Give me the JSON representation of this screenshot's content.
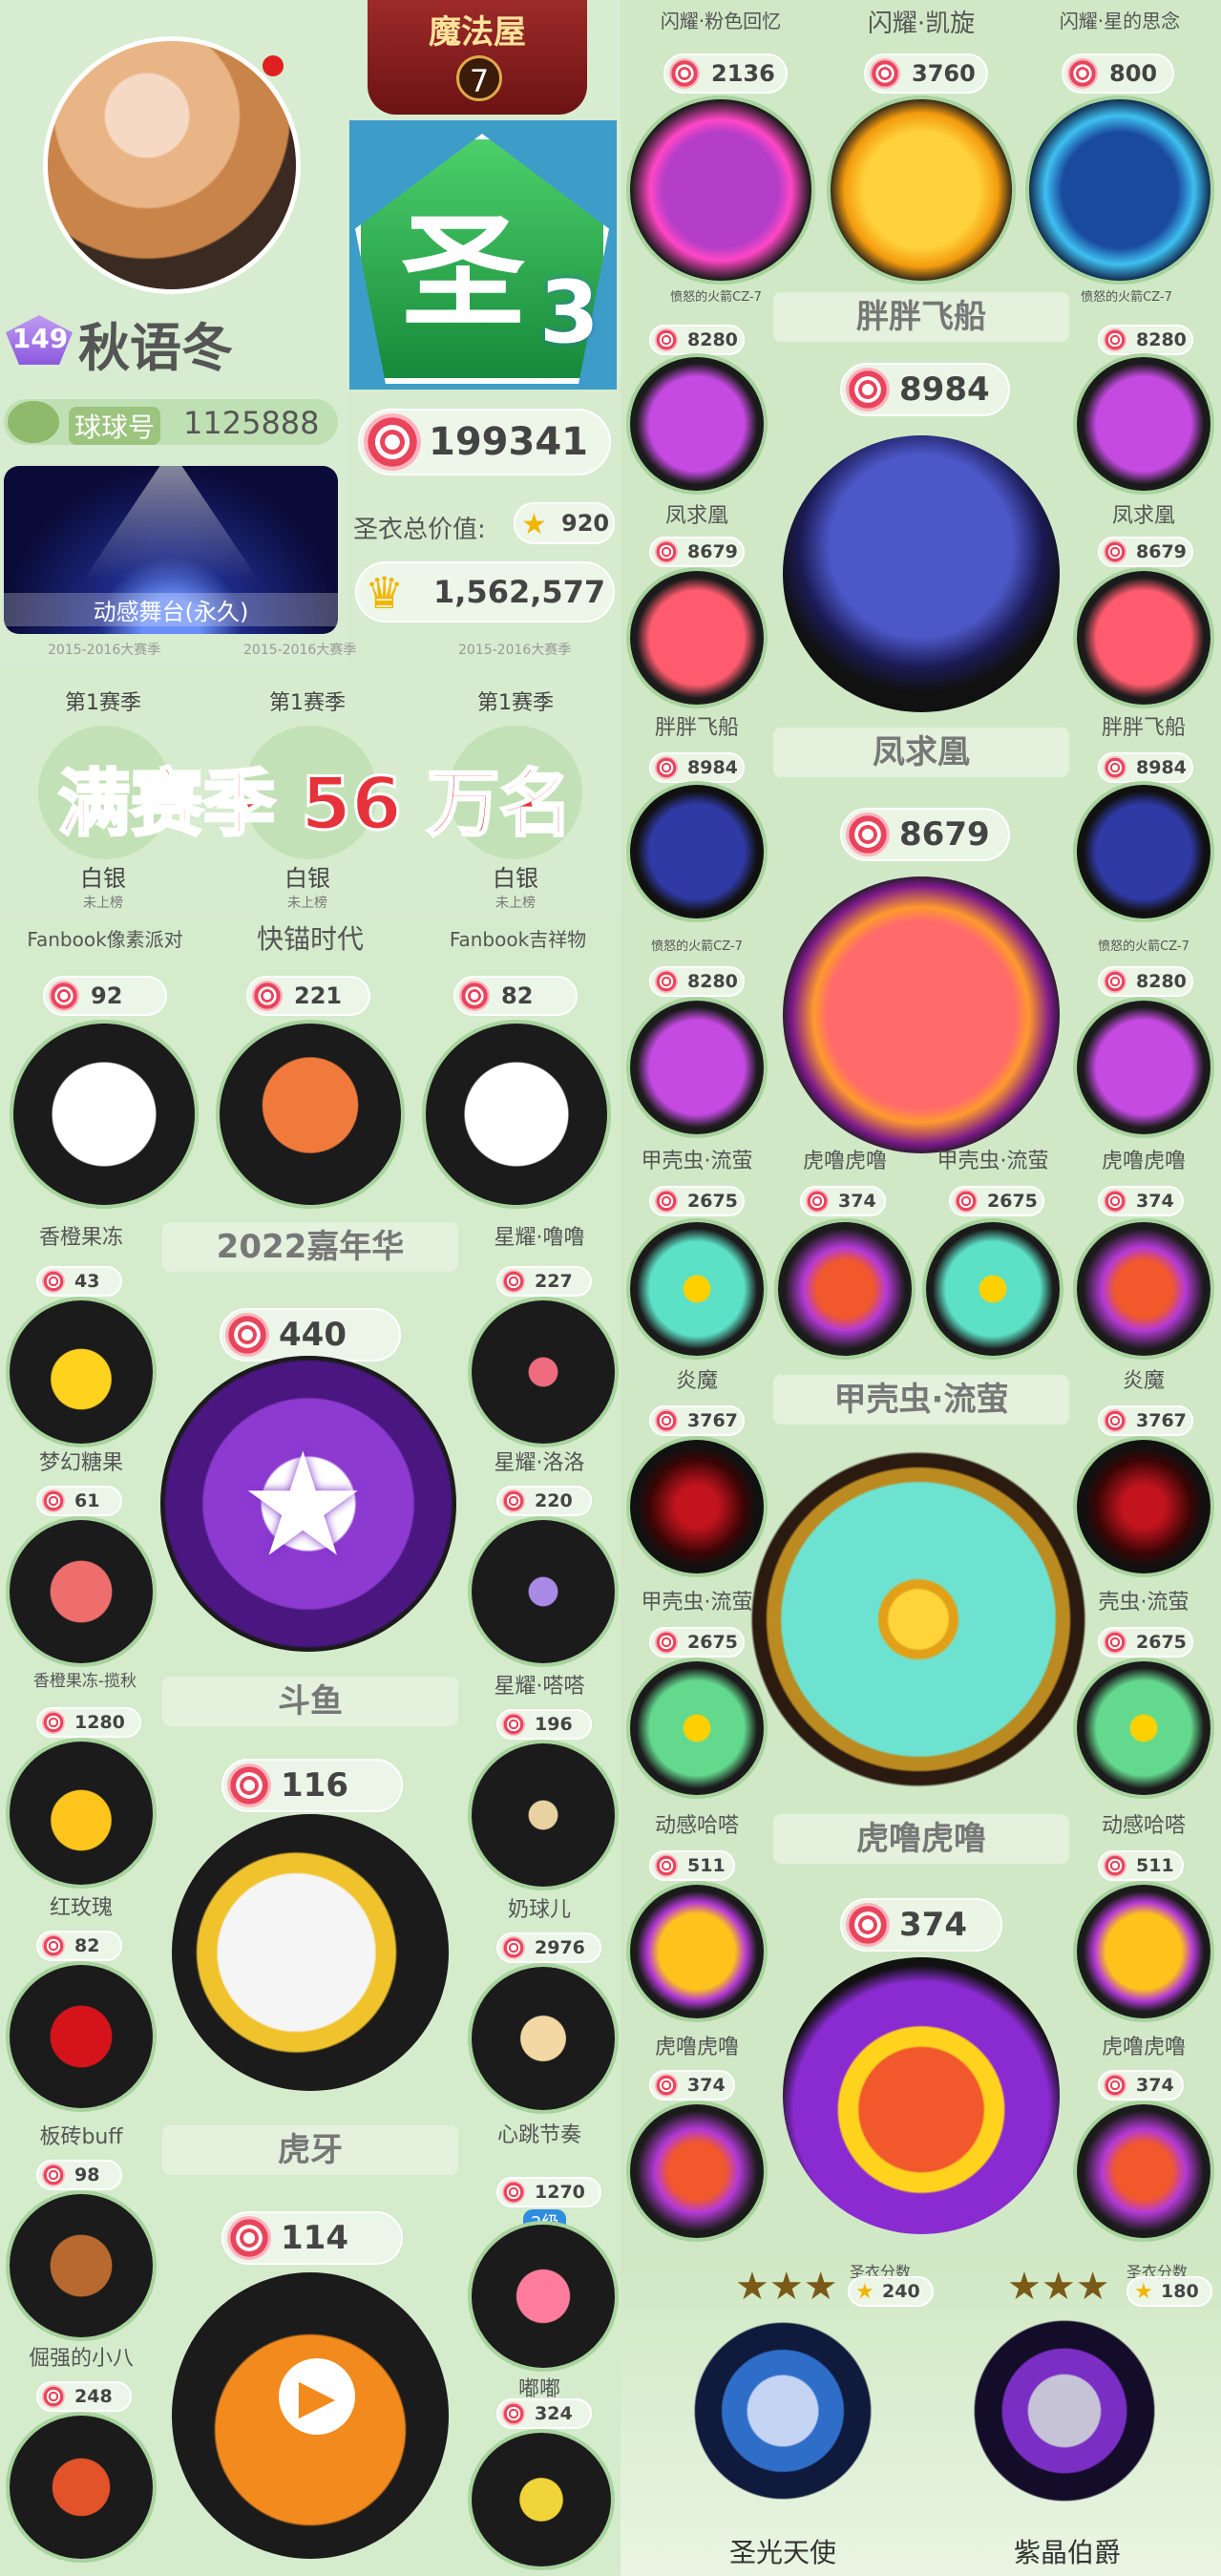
{
  "profile": {
    "level": "149",
    "name": "秋语冬",
    "id_label": "球球号",
    "id_value": "1125888",
    "stage_label": "动感舞台(永久)",
    "season_label_1": "2015-2016大赛季",
    "season_label_2": "2015-2016大赛季",
    "season_label_3": "2015-2016大赛季",
    "house_title": "魔法屋",
    "house_level": "7",
    "saint_char": "圣",
    "saint_num": "3",
    "lollipop_total": "199341",
    "armor_value_label": "圣衣总价值:",
    "armor_value": "920",
    "crown_value": "1,562,577"
  },
  "seasons": {
    "items": [
      {
        "label": "第1赛季",
        "tier": "白银",
        "sub": "未上榜"
      },
      {
        "label": "第1赛季",
        "tier": "白银",
        "sub": "未上榜"
      },
      {
        "label": "第1赛季",
        "tier": "白银",
        "sub": "未上榜"
      }
    ],
    "banner": "满赛季 56 万名"
  },
  "left_items": {
    "row1": [
      {
        "name": "Fanbook像素派对",
        "count": "92"
      },
      {
        "name": "快锚时代",
        "count": "221"
      },
      {
        "name": "Fanbook吉祥物",
        "count": "82"
      }
    ],
    "section_carnival": "2022嘉年华",
    "carnival_count": "440",
    "left_col": [
      {
        "name": "香橙果冻",
        "count": "43"
      },
      {
        "name": "梦幻糖果",
        "count": "61"
      },
      {
        "name": "香橙果冻-揽秋",
        "count": "1280"
      },
      {
        "name": "红玫瑰",
        "count": "82"
      },
      {
        "name": "板砖buff",
        "count": "98"
      },
      {
        "name": "倔强的小八",
        "count": "248"
      }
    ],
    "right_col": [
      {
        "name": "星耀·噜噜",
        "count": "227"
      },
      {
        "name": "星耀·洛洛",
        "count": "220"
      },
      {
        "name": "星耀·嗒嗒",
        "count": "196"
      },
      {
        "name": "奶球儿",
        "count": "2976"
      },
      {
        "name": "心跳节奏",
        "count": "1270"
      },
      {
        "name": "嘟嘟",
        "count": "324"
      }
    ],
    "douyu": "斗鱼",
    "douyu_count": "116",
    "huya": "虎牙",
    "huya_count": "114",
    "heart_level": "2级"
  },
  "right_items": {
    "top_labels": [
      "闪耀·粉色回忆",
      "闪耀·凯旋",
      "闪耀·星的思念"
    ],
    "top_counts": [
      "2136",
      "3760",
      "800"
    ],
    "small_caption": "愤怒的火箭CZ-7",
    "ship_title": "胖胖飞船",
    "ship_count": "8984",
    "phoenix_label": "凤求凰",
    "phoenix_count": "8679",
    "side_a": [
      {
        "name": "凤求凰",
        "count": "8280"
      },
      {
        "name": "胖胖飞船",
        "count": "8679"
      },
      {
        "name": "愤怒的火箭CZ-7",
        "count": "8984"
      },
      {
        "name": "甲壳虫·流萤",
        "count": "8280"
      }
    ],
    "side_b": [
      {
        "name": "凤求凰",
        "count": "8280"
      },
      {
        "name": "胖胖飞船",
        "count": "8679"
      },
      {
        "name": "愤怒的火箭CZ-7",
        "count": "8984"
      },
      {
        "name": "虎噜虎噜",
        "count": "8280"
      }
    ],
    "beetle_row": [
      {
        "name": "甲壳虫·流萤",
        "count": "2675"
      },
      {
        "name": "虎噜虎噜",
        "count": "374"
      },
      {
        "name": "甲壳虫·流萤",
        "count": "2675"
      },
      {
        "name": "虎噜虎噜",
        "count": "374"
      }
    ],
    "beetle_title": "甲壳虫·流萤",
    "flame": [
      {
        "name": "炎魔",
        "count": "3767"
      },
      {
        "name": "炎魔",
        "count": "3767"
      }
    ],
    "beetle_side": [
      {
        "name": "甲壳虫·流萤",
        "count": "2675"
      },
      {
        "name": "壳虫·流萤",
        "count": "2675"
      }
    ],
    "clover": [
      {
        "name": "动感哈嗒",
        "count": "511"
      },
      {
        "name": "动感哈嗒",
        "count": "511"
      }
    ],
    "tiger_title": "虎噜虎噜",
    "tiger_count": "374",
    "tiger_side": [
      {
        "name": "虎噜虎噜",
        "count": "374"
      },
      {
        "name": "虎噜虎噜",
        "count": "374"
      }
    ],
    "armor_label": "圣衣分数",
    "armor_left": "240",
    "armor_right": "180",
    "angel": "圣光天使",
    "duke": "紫晶伯爵"
  }
}
